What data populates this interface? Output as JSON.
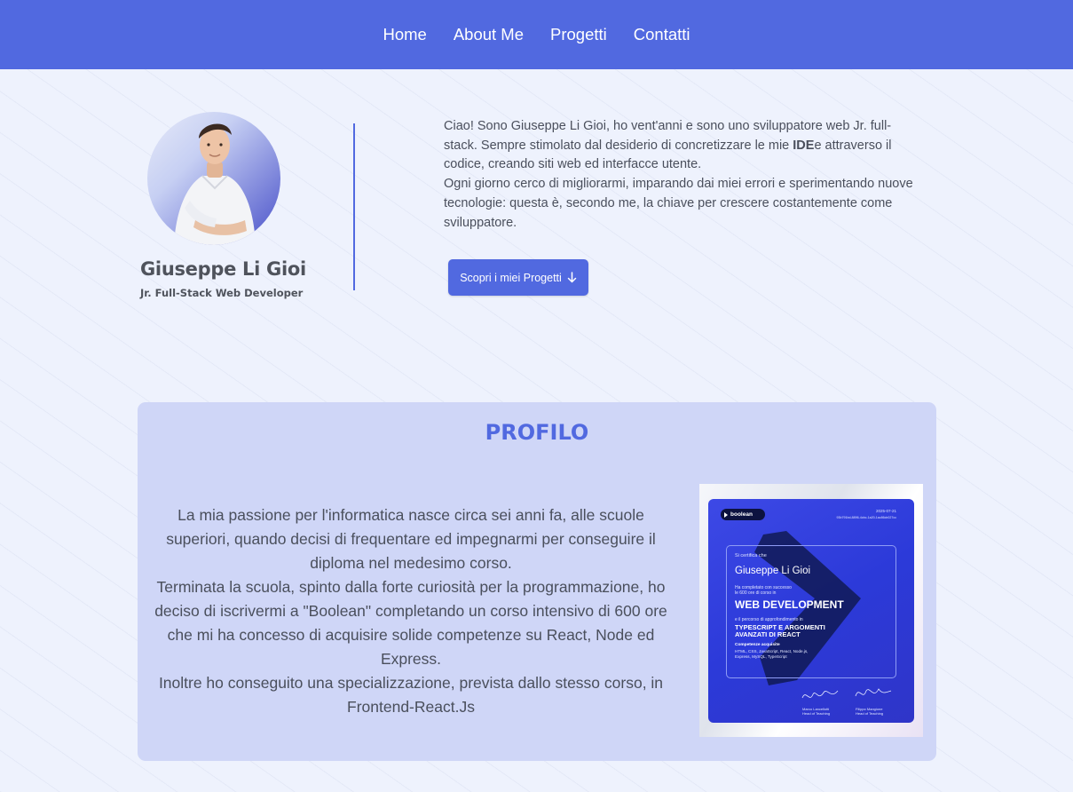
{
  "nav": {
    "items": [
      "Home",
      "About Me",
      "Progetti",
      "Contatti"
    ]
  },
  "hero": {
    "name": "Giuseppe Li Gioi",
    "role": "Jr. Full-Stack Web Developer",
    "intro_p1_a": "Ciao! Sono Giuseppe Li Gioi, ho vent'anni e sono uno sviluppatore web Jr. full-stack. Sempre stimolato dal desiderio di concretizzare le mie ",
    "intro_p1_bold": "IDE",
    "intro_p1_b": "e attraverso il codice, creando siti web ed interfacce utente.",
    "intro_p2": "Ogni giorno cerco di migliorarmi, imparando dai miei errori e sperimentando nuove tecnologie: questa è, secondo me, la chiave per crescere costantemente come sviluppatore.",
    "cta_label": "Scopri i miei Progetti",
    "cta_icon": "arrow-down-icon"
  },
  "profile": {
    "title": "PROFILO",
    "paragraphs": [
      "La mia passione per l'informatica nasce circa sei anni fa, alle scuole superiori, quando decisi di frequentare ed impegnarmi per conseguire il diploma nel medesimo corso.",
      "Terminata la scuola, spinto dalla forte curiosità per la programmazione, ho deciso di iscrivermi a \"Boolean\" completando un corso intensivo di 600 ore che mi ha concesso di acquisire solide competenze su React, Node ed Express.",
      "Inoltre ho conseguito una specializzazione, prevista dallo stesso corso, in Frontend-React.Js"
    ],
    "certificate": {
      "brand": "boolean",
      "date": "2025-07-21",
      "code": "93b791bd-8896-4cbc-1a20-1ac86cb027cc",
      "certifies": "Si certifica che",
      "name": "Giuseppe Li Gioi",
      "completed_line1": "Ha completato con successo",
      "completed_line2": "le 600 ore di corso in",
      "course": "WEB DEVELOPMENT",
      "path_line": "e il percorso di approfondimento in",
      "specialization_line1": "TYPESCRIPT E ARGOMENTI",
      "specialization_line2": "AVANZATI DI REACT",
      "skills_title": "Competenze acquisite",
      "skills_line1": "HTML, CSS, JavaScript, React, Node.js,",
      "skills_line2": "Express, MySQL, TypeScript",
      "signer1_name": "Marco Lancellotti",
      "signer1_role": "Head of Teaching",
      "signer2_name": "Filippo Mangione",
      "signer2_role": "Head of Teaching"
    }
  },
  "colors": {
    "accent": "#5169e0",
    "background": "#eef2fd",
    "card": "#cfd6f7",
    "text": "#4a4f5c"
  }
}
